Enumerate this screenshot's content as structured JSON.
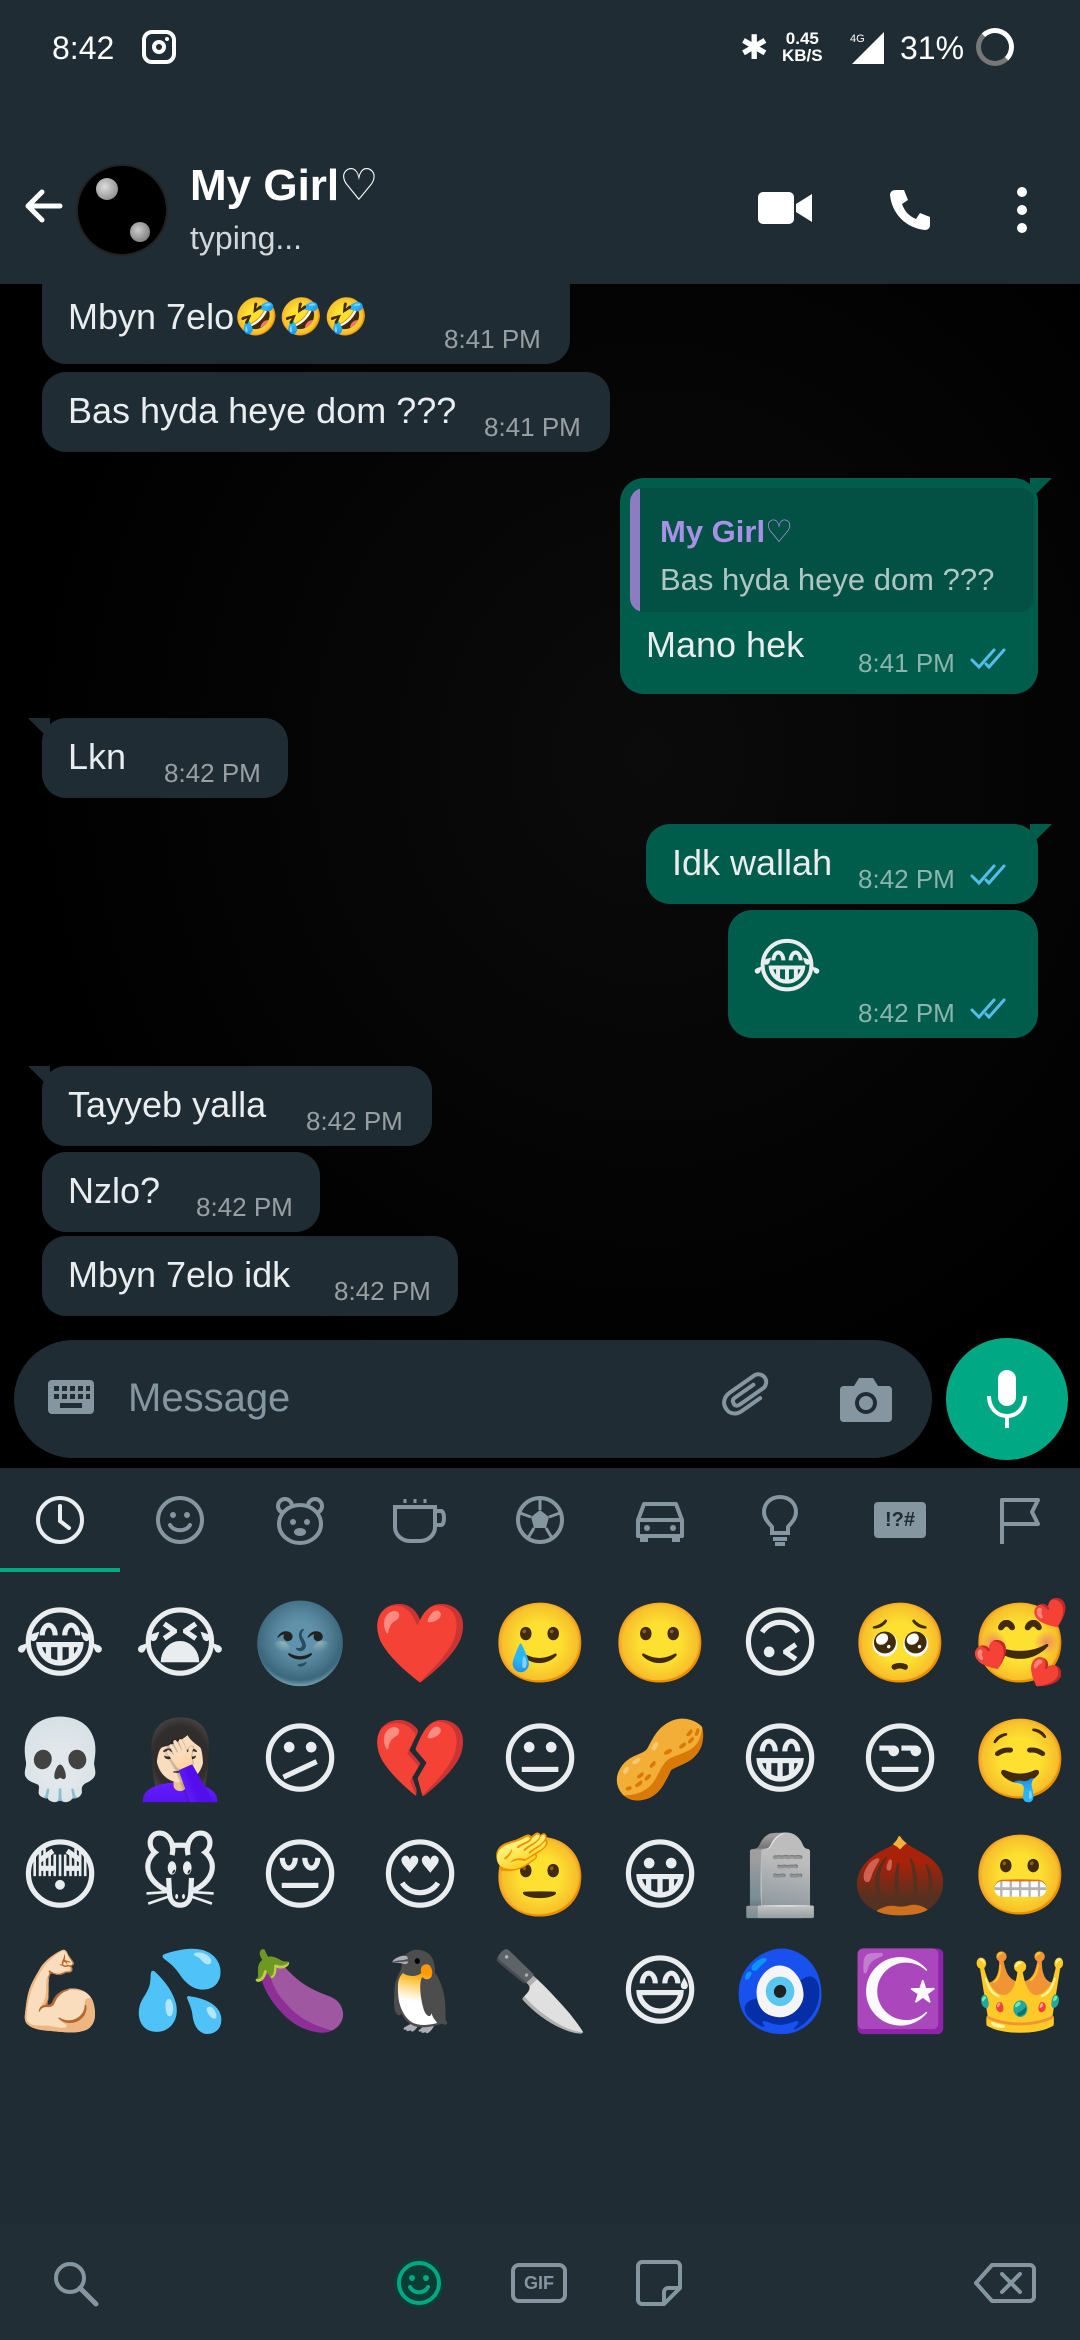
{
  "status_bar": {
    "time": "8:42",
    "net_speed_top": "0.45",
    "net_speed_bottom": "KB/S",
    "network": "4G",
    "battery": "31%"
  },
  "header": {
    "name": "My Girl♡",
    "status": "typing..."
  },
  "messages": [
    {
      "dir": "in",
      "text": "Mbyn 7elo🤣🤣🤣",
      "time": "8:41 PM"
    },
    {
      "dir": "in",
      "text": "Bas hyda heye dom ???",
      "time": "8:41 PM"
    },
    {
      "dir": "out",
      "quote_name": "My Girl♡",
      "quote_text": "Bas hyda heye dom ???",
      "text": "Mano hek",
      "time": "8:41 PM"
    },
    {
      "dir": "in",
      "text": "Lkn",
      "time": "8:42 PM"
    },
    {
      "dir": "out",
      "text": "Idk wallah",
      "time": "8:42 PM"
    },
    {
      "dir": "out",
      "text": "😂",
      "time": "8:42 PM"
    },
    {
      "dir": "in",
      "text": "Tayyeb yalla",
      "time": "8:42 PM"
    },
    {
      "dir": "in",
      "text": "Nzlo?",
      "time": "8:42 PM"
    },
    {
      "dir": "in",
      "text": "Mbyn 7elo idk",
      "time": "8:42 PM"
    }
  ],
  "input": {
    "placeholder": "Message"
  },
  "emoji_tabs": [
    "recent",
    "smileys",
    "animals",
    "food",
    "activities",
    "travel",
    "objects",
    "symbols",
    "flags"
  ],
  "emoji_symbols_tab_label": "!?#",
  "emojis": [
    [
      "😂",
      "😭",
      "🌚",
      "❤️",
      "🥲",
      "🙂",
      "🙃",
      "🥺",
      "🥰"
    ],
    [
      "💀",
      "🤦🏻‍♀️",
      "😕",
      "💔",
      "😐",
      "🥜",
      "😁",
      "😒",
      "🤤"
    ],
    [
      "😳",
      "🐭",
      "😔",
      "😍",
      "🫡",
      "😀",
      "🪦",
      "🌰",
      "😬"
    ],
    [
      "💪🏻",
      "💦",
      "🍆",
      "🐧",
      "🔪",
      "😅",
      "🧿",
      "☪️",
      "👑"
    ]
  ],
  "keyboard_bottom": {
    "gif_label": "GIF"
  },
  "colors": {
    "accent": "#00a884",
    "outgoing_bubble": "#005c4b",
    "incoming_bubble": "#1f2c34",
    "read_ticks": "#53bdeb"
  }
}
